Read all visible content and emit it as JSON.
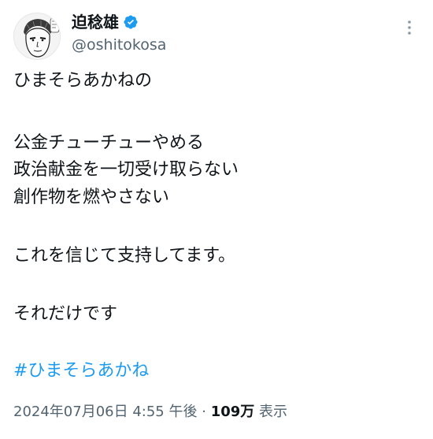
{
  "author": {
    "display_name": "迫稔雄",
    "handle": "@oshitokosa",
    "verified": true,
    "avatar_icon": "manga-portrait-avatar",
    "verified_color": "#1d9bf0"
  },
  "menu_icon": "more-vertical-icon",
  "body_lines": [
    "ひまそらあかねの",
    "公金チューチューやめる",
    "政治献金を一切受け取らない",
    "創作物を燃やさない",
    "これを信じて支持してます。",
    "それだけです"
  ],
  "hashtag": "#ひまそらあかね",
  "hashtag_color": "#1d9bf0",
  "timestamp": "2024年07月06日 4:55 午後",
  "separator": "·",
  "views_count": "109万",
  "views_label": "表示"
}
